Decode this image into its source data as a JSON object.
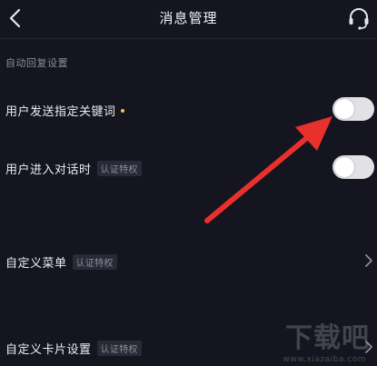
{
  "header": {
    "title": "消息管理",
    "back_icon": "chevron-left-icon",
    "support_icon": "headset-icon"
  },
  "section": {
    "label": "自动回复设置"
  },
  "rows": [
    {
      "label": "用户发送指定关键词",
      "has_dot": true,
      "control": "toggle",
      "state": "off"
    },
    {
      "label": "用户进入对话时",
      "badge": "认证特权",
      "control": "toggle",
      "state": "off"
    },
    {
      "label": "自定义菜单",
      "badge": "认证特权",
      "control": "chevron"
    },
    {
      "label": "自定义卡片设置",
      "badge": "认证特权",
      "control": "chevron"
    }
  ],
  "watermark": {
    "text": "下载吧",
    "sub": "www.xiazaiba.com"
  },
  "colors": {
    "background": "#15151f",
    "accent_dot": "#f6c445",
    "arrow": "#e8302c",
    "toggle_off": "#4a4a58"
  }
}
